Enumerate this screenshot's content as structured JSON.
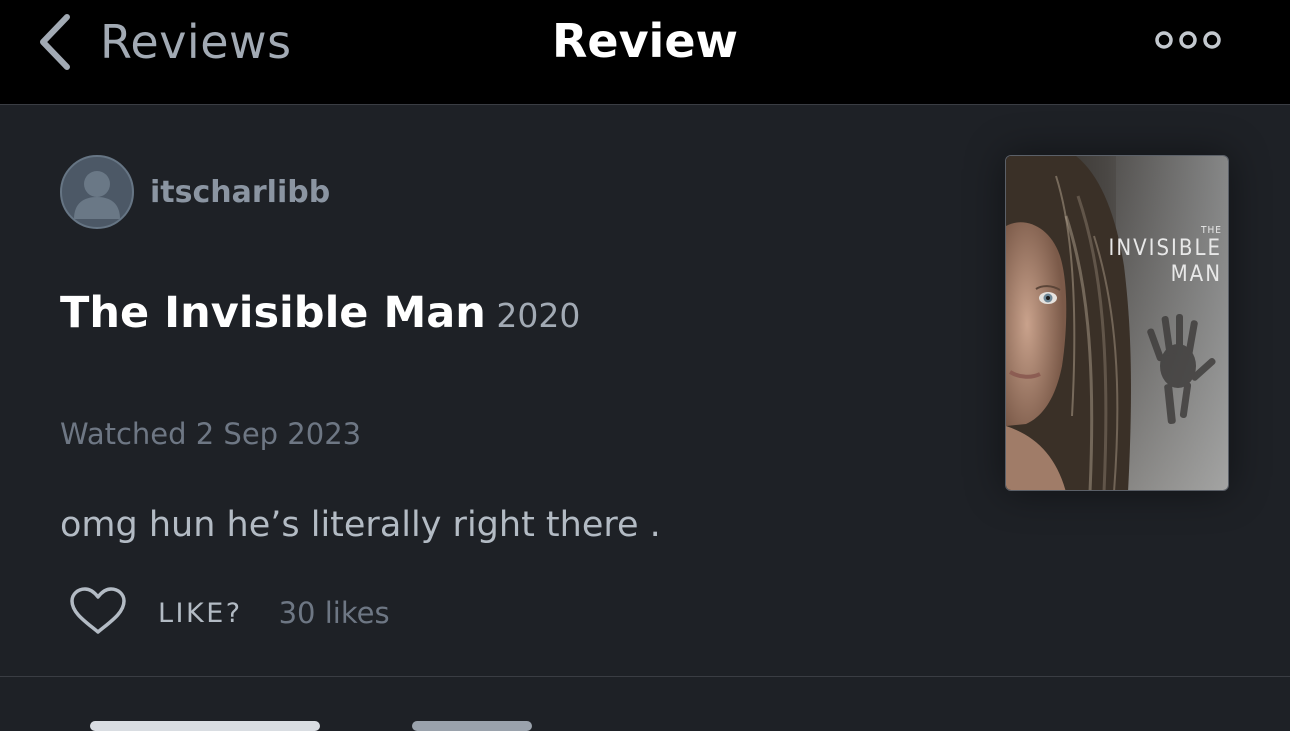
{
  "nav": {
    "back_label": "Reviews",
    "title": "Review",
    "more_icon": "more-icon"
  },
  "review": {
    "username": "itscharlibb",
    "film_title": "The Invisible Man",
    "film_year": "2020",
    "watched": "Watched 2 Sep 2023",
    "text": "omg hun he’s literally right there .",
    "like_label": "LIKE?",
    "likes_count": "30 likes"
  },
  "poster": {
    "title_small": "THE",
    "title_main": "INVISIBLE",
    "title_sub": "MAN"
  },
  "colors": {
    "nav_background": "#000000",
    "page_background": "#1e2126",
    "title_text": "#ffffff",
    "secondary_text": "#a2aab4",
    "muted_text": "#6e7784"
  }
}
